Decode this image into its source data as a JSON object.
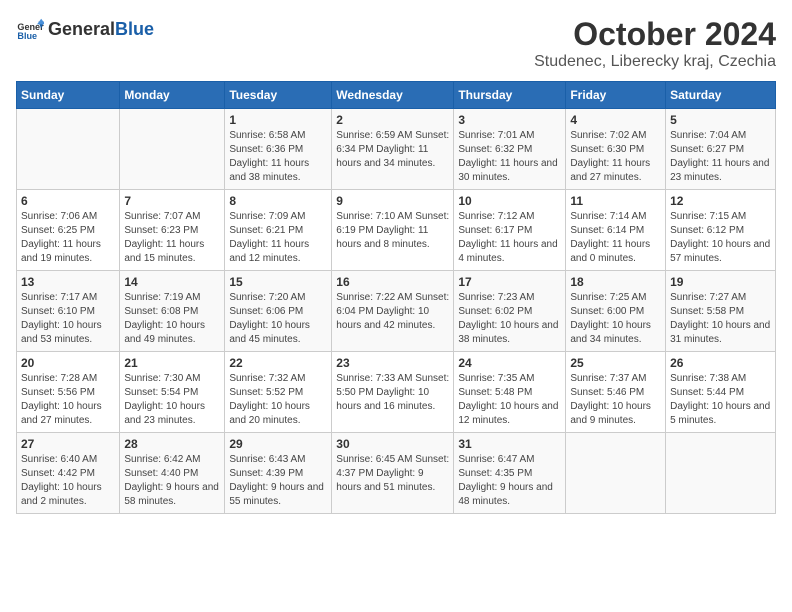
{
  "header": {
    "logo_general": "General",
    "logo_blue": "Blue",
    "title": "October 2024",
    "subtitle": "Studenec, Liberecky kraj, Czechia"
  },
  "calendar": {
    "weekdays": [
      "Sunday",
      "Monday",
      "Tuesday",
      "Wednesday",
      "Thursday",
      "Friday",
      "Saturday"
    ],
    "weeks": [
      [
        {
          "day": "",
          "info": ""
        },
        {
          "day": "",
          "info": ""
        },
        {
          "day": "1",
          "info": "Sunrise: 6:58 AM\nSunset: 6:36 PM\nDaylight: 11 hours and 38 minutes."
        },
        {
          "day": "2",
          "info": "Sunrise: 6:59 AM\nSunset: 6:34 PM\nDaylight: 11 hours and 34 minutes."
        },
        {
          "day": "3",
          "info": "Sunrise: 7:01 AM\nSunset: 6:32 PM\nDaylight: 11 hours and 30 minutes."
        },
        {
          "day": "4",
          "info": "Sunrise: 7:02 AM\nSunset: 6:30 PM\nDaylight: 11 hours and 27 minutes."
        },
        {
          "day": "5",
          "info": "Sunrise: 7:04 AM\nSunset: 6:27 PM\nDaylight: 11 hours and 23 minutes."
        }
      ],
      [
        {
          "day": "6",
          "info": "Sunrise: 7:06 AM\nSunset: 6:25 PM\nDaylight: 11 hours and 19 minutes."
        },
        {
          "day": "7",
          "info": "Sunrise: 7:07 AM\nSunset: 6:23 PM\nDaylight: 11 hours and 15 minutes."
        },
        {
          "day": "8",
          "info": "Sunrise: 7:09 AM\nSunset: 6:21 PM\nDaylight: 11 hours and 12 minutes."
        },
        {
          "day": "9",
          "info": "Sunrise: 7:10 AM\nSunset: 6:19 PM\nDaylight: 11 hours and 8 minutes."
        },
        {
          "day": "10",
          "info": "Sunrise: 7:12 AM\nSunset: 6:17 PM\nDaylight: 11 hours and 4 minutes."
        },
        {
          "day": "11",
          "info": "Sunrise: 7:14 AM\nSunset: 6:14 PM\nDaylight: 11 hours and 0 minutes."
        },
        {
          "day": "12",
          "info": "Sunrise: 7:15 AM\nSunset: 6:12 PM\nDaylight: 10 hours and 57 minutes."
        }
      ],
      [
        {
          "day": "13",
          "info": "Sunrise: 7:17 AM\nSunset: 6:10 PM\nDaylight: 10 hours and 53 minutes."
        },
        {
          "day": "14",
          "info": "Sunrise: 7:19 AM\nSunset: 6:08 PM\nDaylight: 10 hours and 49 minutes."
        },
        {
          "day": "15",
          "info": "Sunrise: 7:20 AM\nSunset: 6:06 PM\nDaylight: 10 hours and 45 minutes."
        },
        {
          "day": "16",
          "info": "Sunrise: 7:22 AM\nSunset: 6:04 PM\nDaylight: 10 hours and 42 minutes."
        },
        {
          "day": "17",
          "info": "Sunrise: 7:23 AM\nSunset: 6:02 PM\nDaylight: 10 hours and 38 minutes."
        },
        {
          "day": "18",
          "info": "Sunrise: 7:25 AM\nSunset: 6:00 PM\nDaylight: 10 hours and 34 minutes."
        },
        {
          "day": "19",
          "info": "Sunrise: 7:27 AM\nSunset: 5:58 PM\nDaylight: 10 hours and 31 minutes."
        }
      ],
      [
        {
          "day": "20",
          "info": "Sunrise: 7:28 AM\nSunset: 5:56 PM\nDaylight: 10 hours and 27 minutes."
        },
        {
          "day": "21",
          "info": "Sunrise: 7:30 AM\nSunset: 5:54 PM\nDaylight: 10 hours and 23 minutes."
        },
        {
          "day": "22",
          "info": "Sunrise: 7:32 AM\nSunset: 5:52 PM\nDaylight: 10 hours and 20 minutes."
        },
        {
          "day": "23",
          "info": "Sunrise: 7:33 AM\nSunset: 5:50 PM\nDaylight: 10 hours and 16 minutes."
        },
        {
          "day": "24",
          "info": "Sunrise: 7:35 AM\nSunset: 5:48 PM\nDaylight: 10 hours and 12 minutes."
        },
        {
          "day": "25",
          "info": "Sunrise: 7:37 AM\nSunset: 5:46 PM\nDaylight: 10 hours and 9 minutes."
        },
        {
          "day": "26",
          "info": "Sunrise: 7:38 AM\nSunset: 5:44 PM\nDaylight: 10 hours and 5 minutes."
        }
      ],
      [
        {
          "day": "27",
          "info": "Sunrise: 6:40 AM\nSunset: 4:42 PM\nDaylight: 10 hours and 2 minutes."
        },
        {
          "day": "28",
          "info": "Sunrise: 6:42 AM\nSunset: 4:40 PM\nDaylight: 9 hours and 58 minutes."
        },
        {
          "day": "29",
          "info": "Sunrise: 6:43 AM\nSunset: 4:39 PM\nDaylight: 9 hours and 55 minutes."
        },
        {
          "day": "30",
          "info": "Sunrise: 6:45 AM\nSunset: 4:37 PM\nDaylight: 9 hours and 51 minutes."
        },
        {
          "day": "31",
          "info": "Sunrise: 6:47 AM\nSunset: 4:35 PM\nDaylight: 9 hours and 48 minutes."
        },
        {
          "day": "",
          "info": ""
        },
        {
          "day": "",
          "info": ""
        }
      ]
    ]
  }
}
